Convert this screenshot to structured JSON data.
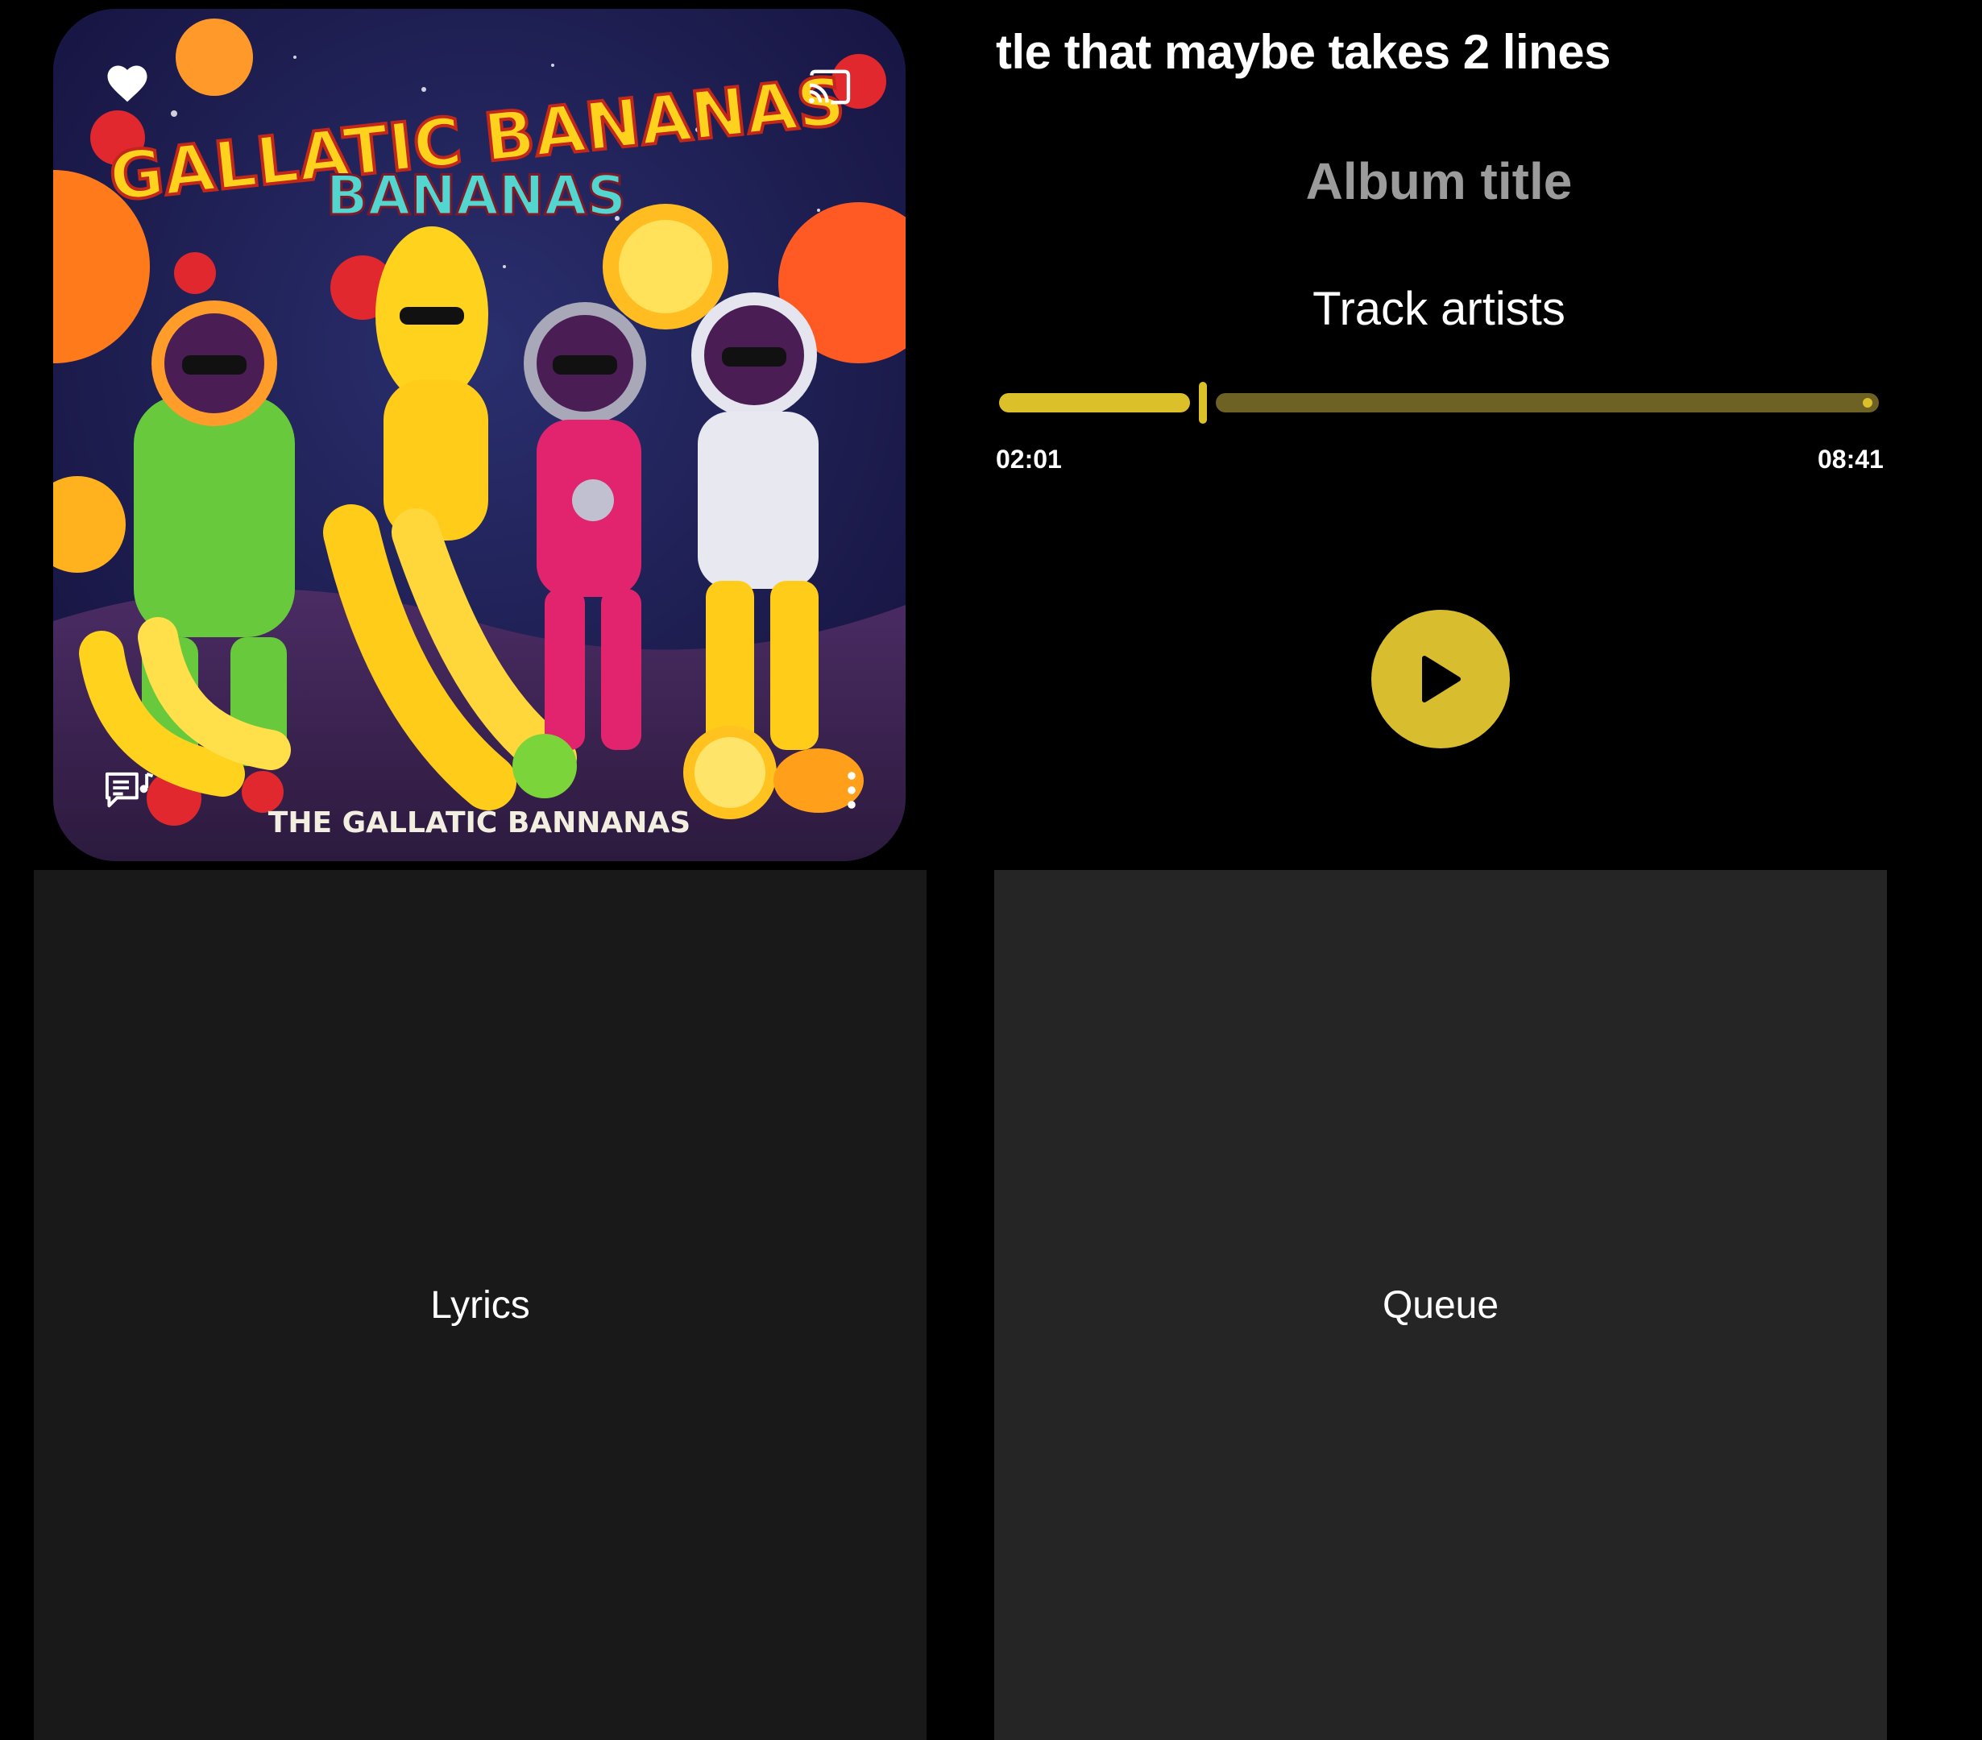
{
  "player": {
    "track_title": "tle that maybe takes 2 lines",
    "album_title": "Album title",
    "track_artists": "Track artists",
    "progress": {
      "elapsed": "02:01",
      "total": "08:41",
      "fraction": 0.232
    }
  },
  "album_art": {
    "headline_top": "GALLATIC BANANAS",
    "headline_sub": "BANANAS",
    "band_name": "THE GALLATIC BANNANAS"
  },
  "icons": {
    "favorite": "heart-icon",
    "cast": "cast-icon",
    "lyrics": "lyrics-icon",
    "more": "more-vertical-icon",
    "play": "play-icon"
  },
  "panels": {
    "lyrics_label": "Lyrics",
    "queue_label": "Queue"
  },
  "colors": {
    "accent": "#dcc02a",
    "accent_dim": "#6d6124",
    "background": "#000000",
    "panel_lyrics": "#191919",
    "panel_queue": "#252525",
    "album_title": "#9b9b9b"
  }
}
